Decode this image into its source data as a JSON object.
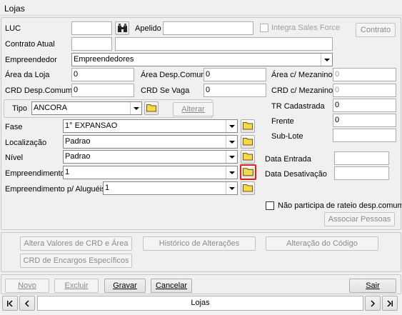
{
  "window": {
    "title": "Lojas"
  },
  "fields": {
    "luc": {
      "label": "LUC",
      "value": ""
    },
    "apelido": {
      "label": "Apelido",
      "value": ""
    },
    "integra_sales_force": {
      "label": "Integra Sales Force",
      "checked": false
    },
    "contrato_button": "Contrato",
    "contrato_atual": {
      "label": "Contrato Atual",
      "value1": "",
      "value2": ""
    },
    "empreendedor": {
      "label": "Empreendedor",
      "value": "Empreendedores"
    },
    "area_loja": {
      "label": "Área da Loja",
      "value": "0"
    },
    "area_desp_comum": {
      "label": "Área Desp.Comum",
      "value": "0"
    },
    "area_mezanino": {
      "label": "Área c/ Mezanino",
      "value": "0"
    },
    "crd_desp_comum": {
      "label": "CRD Desp.Comum",
      "value": "0"
    },
    "crd_se_vaga": {
      "label": "CRD Se Vaga",
      "value": "0"
    },
    "crd_mezanino": {
      "label": "CRD c/ Mezanino",
      "value": "0"
    },
    "tipo": {
      "label": "Tipo",
      "value": "ANCORA"
    },
    "alterar_button": "Alterar",
    "tr_cadastrada": {
      "label": "TR Cadastrada",
      "value": "0"
    },
    "frente": {
      "label": "Frente",
      "value": "0"
    },
    "sub_lote": {
      "label": "Sub-Lote",
      "value": ""
    },
    "fase": {
      "label": "Fase",
      "value": "1° EXPANSAO"
    },
    "localizacao": {
      "label": "Localização",
      "value": "Padrao"
    },
    "nivel": {
      "label": "Nível",
      "value": "Padrao"
    },
    "empreendimento": {
      "label": "Empreendimento",
      "value": "1"
    },
    "empreendimento_alugueis": {
      "label": "Empreendimento p/ Aluguéis",
      "value": "1"
    },
    "data_entrada": {
      "label": "Data Entrada",
      "value": ""
    },
    "data_desativacao": {
      "label": "Data Desativação",
      "value": ""
    },
    "nao_participa": {
      "label": "Não participa de rateio desp.comum",
      "checked": false
    },
    "associar_pessoas": "Associar Pessoas"
  },
  "actions": {
    "altera_valores": "Altera Valores de CRD e Área",
    "historico": "Histórico de Alterações",
    "alteracao_codigo": "Alteração do Código",
    "crd_encargos": "CRD de Encargos Específicos"
  },
  "toolbar": {
    "novo": "Novo",
    "excluir": "Excluir",
    "gravar": "Gravar",
    "cancelar": "Cancelar",
    "sair": "Sair"
  },
  "navigator": {
    "label": "Lojas",
    "first": "|<",
    "prev": "<",
    "next": ">",
    "last": ">|"
  },
  "colors": {
    "highlight": "#e02020"
  }
}
